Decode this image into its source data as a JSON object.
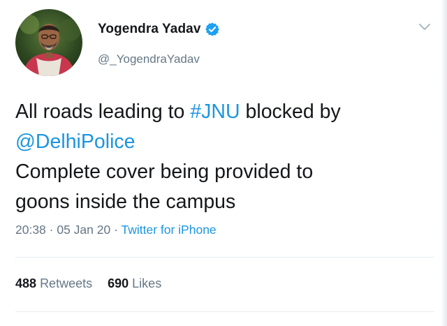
{
  "author": {
    "display_name": "Yogendra Yadav",
    "handle": "@_YogendraYadav",
    "verified_icon": "verified-badge-icon"
  },
  "menu": {
    "icon": "chevron-down-icon"
  },
  "tweet": {
    "text_before_hashtag": "All roads leading to ",
    "hashtag": "#JNU",
    "text_after_hashtag": " blocked by",
    "mention": "@DelhiPolice",
    "line3": "Complete cover being provided to",
    "line4": "goons inside the campus"
  },
  "meta": {
    "time": "20:38",
    "separator": " · ",
    "date": "05 Jan 20",
    "source": "Twitter for iPhone"
  },
  "stats": {
    "retweets_count": "488",
    "retweets_label": "Retweets",
    "likes_count": "690",
    "likes_label": "Likes"
  },
  "colors": {
    "link": "#1b95e0",
    "text": "#14171a",
    "muted": "#657786",
    "divider": "#e6ecf0"
  }
}
